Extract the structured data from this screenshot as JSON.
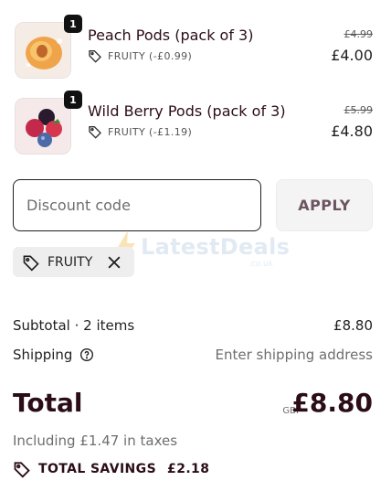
{
  "cart": {
    "items": [
      {
        "title": "Peach Pods (pack of 3)",
        "quantity": "1",
        "discount": "FRUITY (-£0.99)",
        "original_price": "£4.99",
        "price": "£4.00"
      },
      {
        "title": "Wild Berry Pods (pack of 3)",
        "quantity": "1",
        "discount": "FRUITY (-£1.19)",
        "original_price": "£5.99",
        "price": "£4.80"
      }
    ]
  },
  "discount": {
    "placeholder": "Discount code",
    "apply_label": "APPLY",
    "applied_code": "FRUITY"
  },
  "watermark": {
    "text": "LatestDeals",
    "sub": ".co.uk"
  },
  "summary": {
    "subtotal_label": "Subtotal · 2 items",
    "subtotal_value": "£8.80",
    "shipping_label": "Shipping",
    "shipping_value": "Enter shipping address",
    "total_label": "Total",
    "currency": "GBP",
    "total_value": "£8.80",
    "tax_note": "Including £1.47 in taxes",
    "savings_label": "TOTAL SAVINGS",
    "savings_value": "£2.18"
  },
  "colors": {
    "brand_dark": "#2b0d17",
    "input_border": "#1f1f1f",
    "muted_text": "#6e6e6e"
  },
  "icons": [
    "tag-icon",
    "close-icon",
    "help-circle-icon",
    "peach-image",
    "berries-image"
  ]
}
